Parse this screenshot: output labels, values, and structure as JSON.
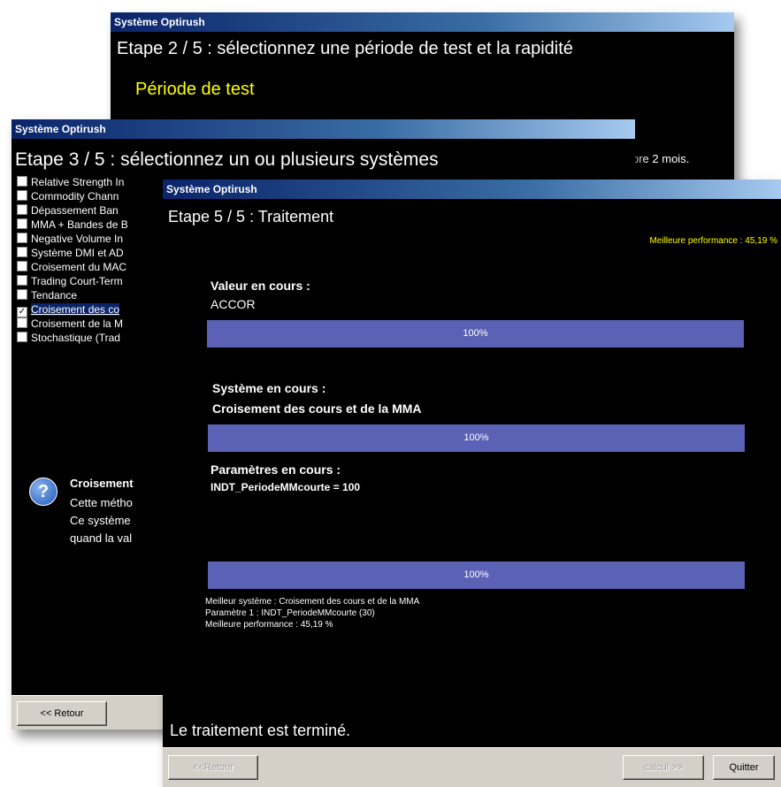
{
  "window_title": "Système Optirush",
  "w2": {
    "step": "Etape 2 / 5 : sélectionnez une période de test et la rapidité",
    "section": "Période de test",
    "fragment": "pre 2 mois."
  },
  "w3": {
    "step": "Etape 3 / 5 : sélectionnez un ou plusieurs systèmes",
    "items": [
      {
        "label": "Relative Strength In",
        "checked": false,
        "selected": false
      },
      {
        "label": "Commodity Chann",
        "checked": false,
        "selected": false
      },
      {
        "label": "Dépassement Ban",
        "checked": false,
        "selected": false
      },
      {
        "label": "MMA + Bandes de B",
        "checked": false,
        "selected": false
      },
      {
        "label": "Negative Volume In",
        "checked": false,
        "selected": false
      },
      {
        "label": "Système DMI et AD",
        "checked": false,
        "selected": false
      },
      {
        "label": "Croisement du MAC",
        "checked": false,
        "selected": false
      },
      {
        "label": "Trading Court-Term",
        "checked": false,
        "selected": false
      },
      {
        "label": "Tendance",
        "checked": false,
        "selected": false
      },
      {
        "label": "Croisement des co",
        "checked": true,
        "selected": true
      },
      {
        "label": "Croisement de la M",
        "checked": false,
        "selected": false
      },
      {
        "label": "Stochastique (Trad",
        "checked": false,
        "selected": false
      }
    ],
    "info_title": "Croisement",
    "info_lines": [
      "Cette métho",
      "Ce système",
      "quand la val"
    ],
    "back_label": "<< Retour"
  },
  "w5": {
    "step": "Etape 5 / 5 : Traitement",
    "best_perf_top": "Meilleure performance : 45,19 %",
    "valeur_label": "Valeur en cours :",
    "valeur_value": "ACCOR",
    "progress1": {
      "text": "100%",
      "value": 100
    },
    "systeme_label": "Système en cours :",
    "systeme_value": "Croisement des cours et de la MMA",
    "progress2": {
      "text": "100%",
      "value": 100
    },
    "params_label": "Paramètres en cours :",
    "params_value": "INDT_PeriodeMMcourte = 100",
    "progress3": {
      "text": "100%",
      "value": 100
    },
    "summary": [
      "Meilleur système : Croisement des cours et de la MMA",
      "Paramètre 1 : INDT_PeriodeMMcourte (30)",
      "Meilleure performance : 45,19 %"
    ],
    "done_text": "Le traitement est terminé.",
    "back_label": "<<Retour",
    "next_label": "calcul >>",
    "quit_label": "Quitter"
  },
  "colors": {
    "title_start": "#0a246a",
    "title_end": "#a6caf0",
    "progress": "#5b62b6",
    "highlight": "#ffff00"
  }
}
